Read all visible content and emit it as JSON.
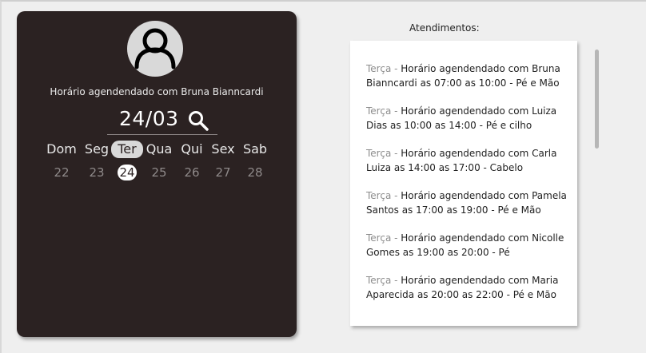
{
  "profile": {
    "subtitle": "Horário agendendado com Bruna Bianncardi",
    "date": "24/03"
  },
  "week": [
    {
      "label": "Dom",
      "day": "22"
    },
    {
      "label": "Seg",
      "day": "23"
    },
    {
      "label": "Ter",
      "day": "24",
      "selected": true
    },
    {
      "label": "Qua",
      "day": "25"
    },
    {
      "label": "Qui",
      "day": "26"
    },
    {
      "label": "Sex",
      "day": "27"
    },
    {
      "label": "Sab",
      "day": "28"
    }
  ],
  "appointments": {
    "title": "Atendimentos:",
    "items": [
      {
        "weekday": "Terça - ",
        "line1": "Horário agendendado com Bruna",
        "line2": "Bianncardi as 07:00 as 10:00 - Pé e Mão"
      },
      {
        "weekday": "Terça - ",
        "line1": "Horário agendendado com Luiza",
        "line2": "Dias as 10:00 as 14:00 - Pé e cilho"
      },
      {
        "weekday": "Terça - ",
        "line1": "Horário agendendado com Carla",
        "line2": "Luiza as 14:00 as 17:00 - Cabelo"
      },
      {
        "weekday": "Terça - ",
        "line1": "Horário agendendado com Pamela",
        "line2": "Santos as 17:00 as 19:00 - Pé e Mão"
      },
      {
        "weekday": "Terça - ",
        "line1": "Horário agendendado com Nicolle",
        "line2": "Gomes as 19:00 as 20:00 - Pé"
      },
      {
        "weekday": "Terça - ",
        "line1": "Horário agendendado com Maria",
        "line2": "Aparecida as 20:00 as 22:00 - Pé e Mão"
      }
    ]
  },
  "colors": {
    "card": "#2b2222",
    "accent_weekday": "#8d8d8d"
  },
  "icons": [
    "user-icon",
    "search-icon"
  ]
}
